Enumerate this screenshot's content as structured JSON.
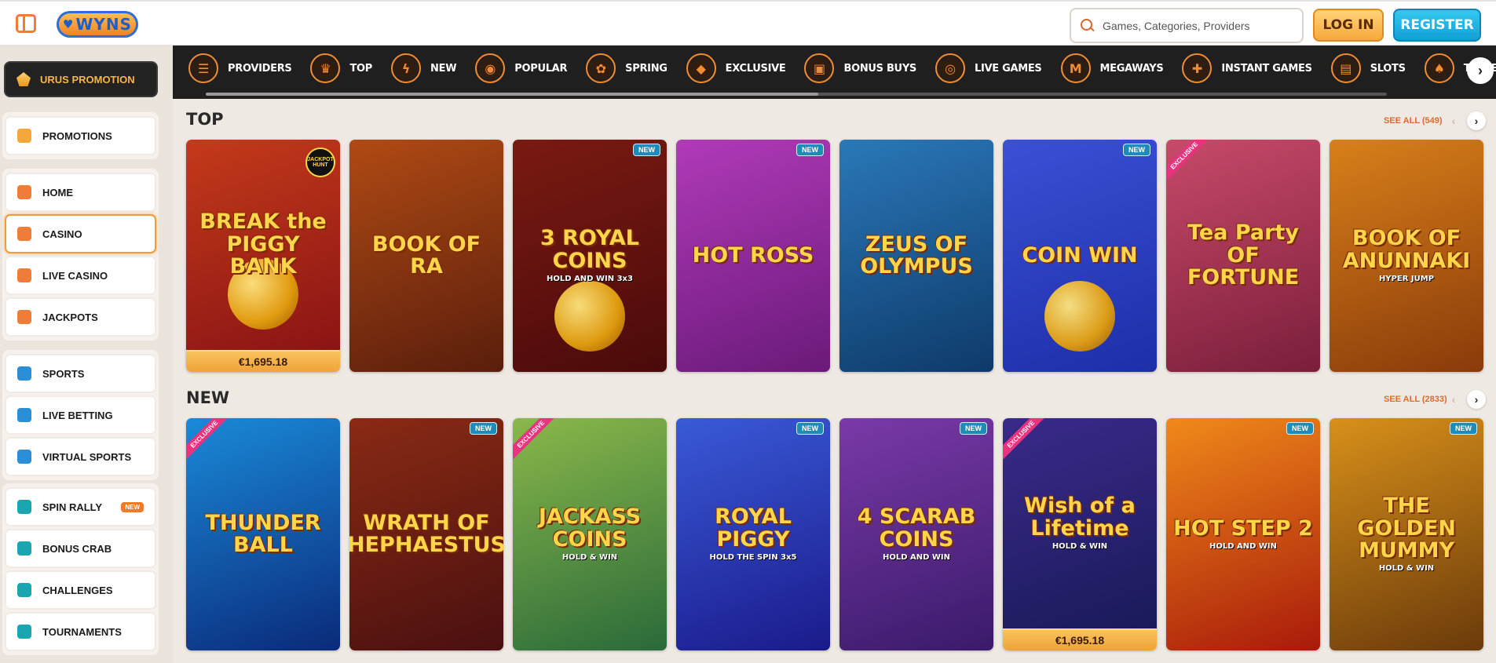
{
  "header": {
    "logo_text": "WYNS",
    "search_placeholder": "Games, Categories, Providers",
    "login_label": "LOG IN",
    "register_label": "REGISTER"
  },
  "sidebar": {
    "promo": {
      "label": "URUS PROMOTION",
      "icon": "helmet-icon"
    },
    "groups": [
      {
        "items": [
          {
            "label": "PROMOTIONS",
            "icon": "gift-icon",
            "color": "#f2a63b"
          }
        ]
      },
      {
        "items": [
          {
            "label": "HOME",
            "icon": "home-icon",
            "color": "#ef7d3a"
          },
          {
            "label": "CASINO",
            "icon": "slot-machine-icon",
            "color": "#ef7d3a",
            "active": true
          },
          {
            "label": "LIVE CASINO",
            "icon": "live-casino-icon",
            "color": "#ef7d3a"
          },
          {
            "label": "JACKPOTS",
            "icon": "clover-icon",
            "color": "#ef7d3a"
          }
        ]
      },
      {
        "items": [
          {
            "label": "SPORTS",
            "icon": "ball-icon",
            "color": "#2a8fd6"
          },
          {
            "label": "LIVE BETTING",
            "icon": "live-tv-icon",
            "color": "#2a8fd6"
          },
          {
            "label": "VIRTUAL SPORTS",
            "icon": "monitor-icon",
            "color": "#2a8fd6"
          }
        ]
      },
      {
        "items": [
          {
            "label": "SPIN RALLY",
            "icon": "flag-icon",
            "color": "#1aa6b0",
            "badge": "NEW"
          },
          {
            "label": "BONUS CRAB",
            "icon": "crab-icon",
            "color": "#1aa6b0"
          },
          {
            "label": "CHALLENGES",
            "icon": "medal-icon",
            "color": "#1aa6b0"
          },
          {
            "label": "TOURNAMENTS",
            "icon": "podium-icon",
            "color": "#1aa6b0"
          }
        ]
      }
    ]
  },
  "categories": [
    {
      "label": "PROVIDERS",
      "icon": "providers-icon",
      "glyph": "☰"
    },
    {
      "label": "TOP",
      "icon": "crown-icon",
      "glyph": "♛"
    },
    {
      "label": "NEW",
      "icon": "lightning-icon",
      "glyph": "ϟ"
    },
    {
      "label": "POPULAR",
      "icon": "flame-icon",
      "glyph": "◉"
    },
    {
      "label": "SPRING",
      "icon": "butterfly-icon",
      "glyph": "✿"
    },
    {
      "label": "EXCLUSIVE",
      "icon": "diamond-icon",
      "glyph": "◆"
    },
    {
      "label": "BONUS BUYS",
      "icon": "gift-box-icon",
      "glyph": "▣"
    },
    {
      "label": "LIVE GAMES",
      "icon": "live-chip-icon",
      "glyph": "◎"
    },
    {
      "label": "MEGAWAYS",
      "icon": "megaways-icon",
      "glyph": "M"
    },
    {
      "label": "INSTANT GAMES",
      "icon": "gamepad-icon",
      "glyph": "✚"
    },
    {
      "label": "SLOTS",
      "icon": "slots-icon",
      "glyph": "▤"
    },
    {
      "label": "TABLE GAMES",
      "icon": "cards-icon",
      "glyph": "♠"
    }
  ],
  "sections": [
    {
      "title": "TOP",
      "see_all": "SEE ALL (549)",
      "games": [
        {
          "name": "BREAK the PIGGY BANK",
          "bg": "#8a1414",
          "bg2": "#c43a1a",
          "jackpot": "€1,695.18",
          "hunt": "JACKPOT HUNT",
          "coin": true
        },
        {
          "name": "BOOK OF RA",
          "bg": "#5a1e0c",
          "bg2": "#b04a14"
        },
        {
          "name": "3 ROYAL COINS",
          "sub": "HOLD AND WIN 3x3",
          "bg": "#4a0a0a",
          "bg2": "#7a1a12",
          "new": "NEW",
          "coin": true
        },
        {
          "name": "HOT ROSS",
          "bg": "#6a1a7a",
          "bg2": "#b13ab8",
          "new": "NEW"
        },
        {
          "name": "ZEUS OF OLYMPUS",
          "bg": "#0e3a6a",
          "bg2": "#2a78b8"
        },
        {
          "name": "COIN WIN",
          "bg": "#1d2ea8",
          "bg2": "#3b50d6",
          "new": "NEW",
          "coin": true
        },
        {
          "name": "Tea Party OF FORTUNE",
          "bg": "#7a1e3a",
          "bg2": "#c84a6a",
          "exclusive": "EXCLUSIVE"
        },
        {
          "name": "BOOK OF ANUNNAKI",
          "sub": "HYPER JUMP",
          "bg": "#8a3a0a",
          "bg2": "#d8801a"
        }
      ]
    },
    {
      "title": "NEW",
      "see_all": "SEE ALL (2833)",
      "games": [
        {
          "name": "THUNDER BALL",
          "bg": "#0a2a7a",
          "bg2": "#1a8ad8",
          "exclusive": "EXCLUSIVE"
        },
        {
          "name": "WRATH OF HEPHAESTUS",
          "bg": "#4a1010",
          "bg2": "#8a2a14",
          "new": "NEW"
        },
        {
          "name": "JACKASS COINS",
          "sub": "HOLD & WIN",
          "bg": "#2a6a3a",
          "bg2": "#8ab84a",
          "exclusive": "EXCLUSIVE"
        },
        {
          "name": "ROYAL PIGGY",
          "sub": "HOLD THE SPIN 3x5",
          "bg": "#1a1a8a",
          "bg2": "#3a5ad8",
          "new": "NEW"
        },
        {
          "name": "4 SCARAB COINS",
          "sub": "HOLD AND WIN",
          "bg": "#3a1a6a",
          "bg2": "#7a3aa8",
          "new": "NEW"
        },
        {
          "name": "Wish of a Lifetime",
          "sub": "HOLD & WIN",
          "bg": "#1a1a5a",
          "bg2": "#3a2a8a",
          "exclusive": "EXCLUSIVE",
          "jackpot": "€1,695.18"
        },
        {
          "name": "HOT STEP 2",
          "sub": "HOLD AND WIN",
          "bg": "#a81a0a",
          "bg2": "#f08a1a",
          "new": "NEW"
        },
        {
          "name": "THE GOLDEN MUMMY",
          "sub": "HOLD & WIN",
          "bg": "#6a3a0a",
          "bg2": "#d8901a",
          "new": "NEW"
        }
      ]
    }
  ]
}
